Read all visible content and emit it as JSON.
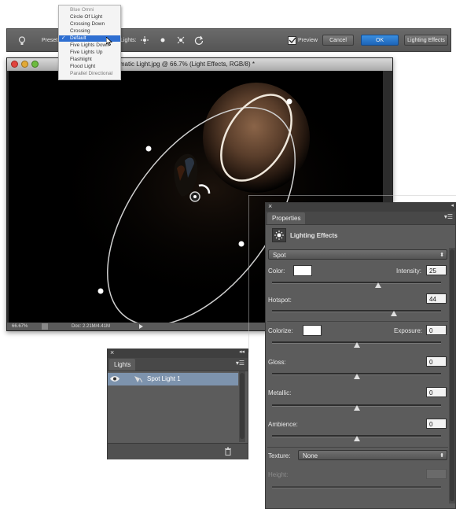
{
  "options_bar": {
    "presets_label": "Preset",
    "lights_label": "Lights:",
    "preview_label": "Preview",
    "preview_checked": true,
    "cancel_label": "Cancel",
    "ok_label": "OK",
    "workspace_label": "Lighting Effects"
  },
  "preset_menu": {
    "items": [
      "Blue Omni",
      "Circle Of Light",
      "Crossing Down",
      "Crossing",
      "Default",
      "Five Lights Down",
      "Five Lights Up",
      "Flashlight",
      "Flood Light",
      "Parallel Directional"
    ],
    "selected": "Default"
  },
  "document": {
    "title": "Dramatic Light.jpg @ 66.7% (Light Effects, RGB/8) *",
    "zoom": "66.67%",
    "doc_info": "Doc: 2.21M/4.41M"
  },
  "properties": {
    "tab_label": "Properties",
    "header_title": "Lighting Effects",
    "light_type": "Spot",
    "color_label": "Color:",
    "intensity_label": "Intensity:",
    "intensity_value": "25",
    "hotspot_label": "Hotspot:",
    "hotspot_value": "44",
    "colorize_label": "Colorize:",
    "exposure_label": "Exposure:",
    "exposure_value": "0",
    "gloss_label": "Gloss:",
    "gloss_value": "0",
    "metallic_label": "Metallic:",
    "metallic_value": "0",
    "ambience_label": "Ambience:",
    "ambience_value": "0",
    "texture_label": "Texture:",
    "texture_value": "None",
    "height_label": "Height:",
    "sliders": {
      "intensity": 0.63,
      "hotspot": 0.72,
      "exposure": 0.5,
      "gloss": 0.5,
      "metallic": 0.5,
      "ambience": 0.5
    }
  },
  "lights_panel": {
    "tab_label": "Lights",
    "items": [
      {
        "label": "Spot Light 1",
        "visible": true
      }
    ]
  },
  "colors": {
    "panel_bg": "#5c5c5c",
    "selection_blue": "#2f6fd1",
    "ok_blue": "#2a7ad3"
  }
}
